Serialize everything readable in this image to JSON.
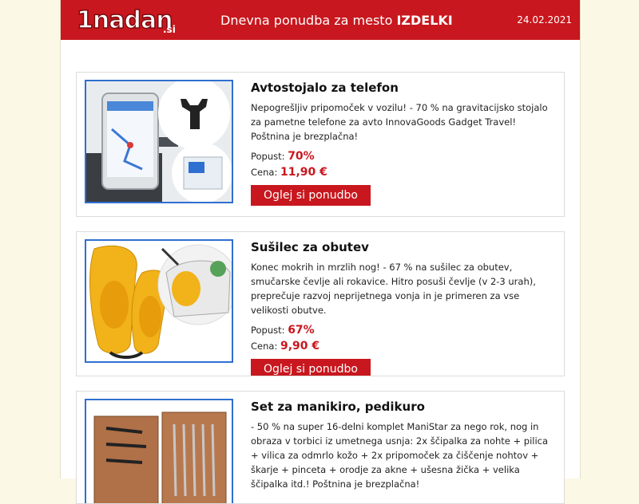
{
  "header": {
    "logo_text": "1nadan",
    "logo_suffix": ".si",
    "title_prefix": "Dnevna ponudba za mesto ",
    "title_city": "IZDELKI",
    "date": "24.02.2021"
  },
  "colors": {
    "brand": "#c8171e",
    "image_border": "#2f6fd0",
    "page_bg": "#fbf8e6"
  },
  "labels": {
    "discount": "Popust:",
    "price": "Cena:",
    "cta": "Oglej si ponudbo"
  },
  "offers": [
    {
      "title": "Avtostojalo za telefon",
      "description": "Nepogrešljiv pripomoček v vozilu! - 70 % na gravitacijsko stojalo za pametne telefone za avto InnovaGoods Gadget Travel! Poštnina je brezplačna!",
      "discount": "70%",
      "price": "11,90 €",
      "image_icon": "car-phone-holder-image"
    },
    {
      "title": "Sušilec za obutev",
      "description": "Konec mokrih in mrzlih nog! - 67 % na sušilec za obutev, smučarske čevlje ali rokavice. Hitro posuši čevlje (v 2-3 urah), preprečuje razvoj neprijetnega vonja in je primeren za vse velikosti obutve.",
      "discount": "67%",
      "price": "9,90 €",
      "image_icon": "shoe-dryer-image"
    },
    {
      "title": "Set za manikiro, pedikuro",
      "description": "- 50 % na super 16-delni komplet ManiStar za nego rok, nog in obraza v torbici iz umetnega usnja: 2x ščipalka za nohte + pilica + vilica za odmrlo kožo + 2x pripomoček za čiščenje nohtov + škarje + pinceta + orodje za akne + ušesna žička + velika ščipalka itd.! Poštnina je brezplačna!",
      "discount": "50%",
      "price": "",
      "image_icon": "manicure-set-image"
    }
  ]
}
